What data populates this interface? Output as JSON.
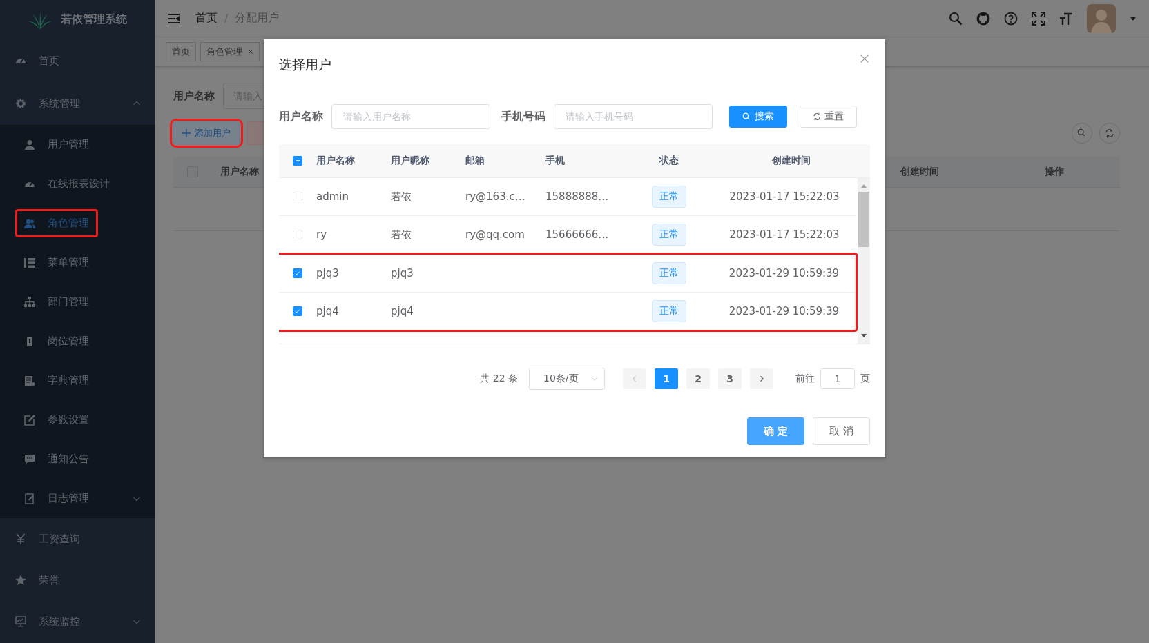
{
  "sidebar": {
    "logo_text": "若依管理系统",
    "items": [
      {
        "label": "首页",
        "selected": false
      },
      {
        "label": "系统管理",
        "expanded": true,
        "selected": false,
        "children": [
          {
            "label": "用户管理",
            "selected": false,
            "highlighted": false
          },
          {
            "label": "在线报表设计",
            "selected": false,
            "highlighted": false
          },
          {
            "label": "角色管理",
            "selected": true,
            "highlighted": true
          },
          {
            "label": "菜单管理",
            "selected": false,
            "highlighted": false
          },
          {
            "label": "部门管理",
            "selected": false,
            "highlighted": false
          },
          {
            "label": "岗位管理",
            "selected": false,
            "highlighted": false
          },
          {
            "label": "字典管理",
            "selected": false,
            "highlighted": false
          },
          {
            "label": "参数设置",
            "selected": false,
            "highlighted": false
          },
          {
            "label": "通知公告",
            "selected": false,
            "highlighted": false
          },
          {
            "label": "日志管理",
            "selected": false,
            "highlighted": false,
            "expanded": false
          }
        ]
      },
      {
        "label": "工资查询",
        "selected": false
      },
      {
        "label": "荣誉",
        "selected": false
      },
      {
        "label": "系统监控",
        "selected": false,
        "expanded": false
      }
    ]
  },
  "header": {
    "breadcrumb": [
      "首页",
      "分配用户"
    ],
    "separator": "/"
  },
  "tags": [
    {
      "label": "首页",
      "selected": false,
      "closable": false
    },
    {
      "label": "角色管理",
      "selected": false,
      "closable": true
    }
  ],
  "page": {
    "search_label": "用户名称",
    "search_placeholder": "请输入",
    "add_button": {
      "label": "添加用户",
      "highlighted": true
    },
    "select_all": {
      "checked": false
    },
    "table_columns": [
      "用户名称",
      "创建时间",
      "操作"
    ]
  },
  "dialog": {
    "title": "选择用户",
    "fields": [
      {
        "label": "用户名称",
        "placeholder": "请输入用户名称"
      },
      {
        "label": "手机号码",
        "placeholder": "请输入手机号码"
      }
    ],
    "search_button": "搜索",
    "reset_button": "重置",
    "select_all": {
      "indeterminate": true
    },
    "columns": [
      "用户名称",
      "用户昵称",
      "邮箱",
      "手机",
      "状态",
      "创建时间"
    ],
    "rows": [
      {
        "cells": [
          "admin",
          "若依",
          "ry@163.c…",
          "15888888…",
          "正常",
          "2023-01-17 15:22:03"
        ],
        "checked": false,
        "highlighted": false
      },
      {
        "cells": [
          "ry",
          "若依",
          "ry@qq.com",
          "15666666…",
          "正常",
          "2023-01-17 15:22:03"
        ],
        "checked": false,
        "highlighted": false
      },
      {
        "cells": [
          "pjq3",
          "pjq3",
          "",
          "",
          "正常",
          "2023-01-29 10:59:39"
        ],
        "checked": true,
        "highlighted": true
      },
      {
        "cells": [
          "pjq4",
          "pjq4",
          "",
          "",
          "正常",
          "2023-01-29 10:59:39"
        ],
        "checked": true,
        "highlighted": true
      }
    ],
    "pagination": {
      "total": "共 22 条",
      "page_size": "10条/页",
      "pages": [
        {
          "label": "1",
          "selected": true
        },
        {
          "label": "2",
          "selected": false
        },
        {
          "label": "3",
          "selected": false
        }
      ],
      "goto_label": "前往",
      "goto_value": "1",
      "goto_suffix": "页"
    },
    "confirm_button": "确 定",
    "cancel_button": "取 消"
  }
}
